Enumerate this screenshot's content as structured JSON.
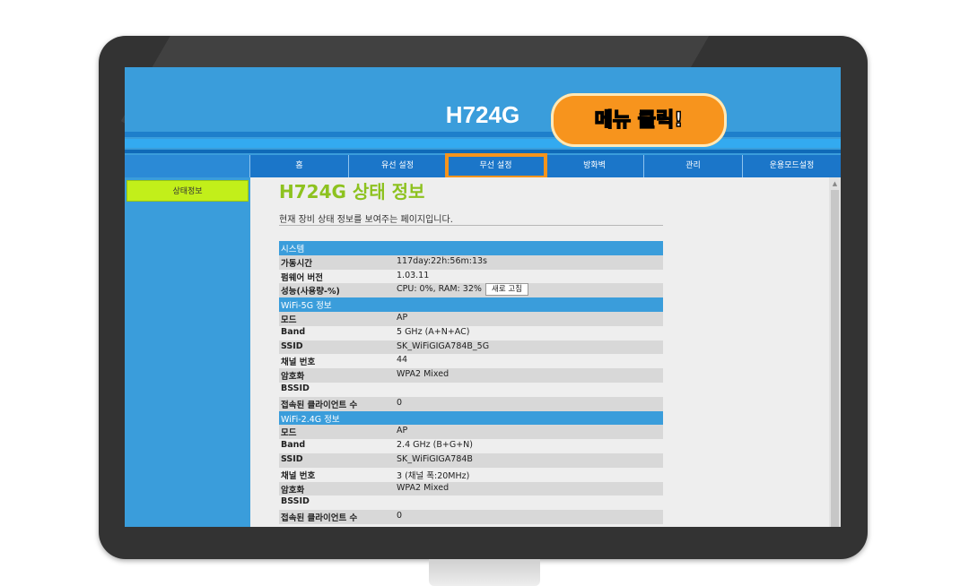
{
  "header": {
    "title": "H724G"
  },
  "nav": {
    "items": [
      {
        "label": "홈"
      },
      {
        "label": "유선 설정"
      },
      {
        "label": "무선 설정"
      },
      {
        "label": "방화벽"
      },
      {
        "label": "관리"
      },
      {
        "label": "운용모드설정"
      }
    ],
    "highlight_color": "#f5941d"
  },
  "sidebar": {
    "items": [
      {
        "label": "상태정보"
      }
    ]
  },
  "page": {
    "title": "H724G 상태 정보",
    "description": "현재 장비 상태 정보를 보여주는 페이지입니다."
  },
  "system": {
    "header": "시스템",
    "rows": [
      {
        "key": "가동시간",
        "value": "117day:22h:56m:13s"
      },
      {
        "key": "펌웨어 버전",
        "value": "1.03.11"
      },
      {
        "key": "성능(사용량-%)",
        "value": "CPU: 0%, RAM: 32%"
      }
    ],
    "refresh_label": "새로 고침"
  },
  "wifi5": {
    "header": "WiFi-5G 정보",
    "rows": [
      {
        "key": "모드",
        "value": "AP"
      },
      {
        "key": "Band",
        "value": "5 GHz (A+N+AC)"
      },
      {
        "key": "SSID",
        "value": "SK_WiFiGIGA784B_5G"
      },
      {
        "key": "채널 번호",
        "value": "44"
      },
      {
        "key": "암호화",
        "value": "WPA2 Mixed"
      },
      {
        "key": "BSSID",
        "value": ""
      },
      {
        "key": "접속된 클라이언트 수",
        "value": "0"
      }
    ]
  },
  "wifi24": {
    "header": "WiFi-2.4G 정보",
    "rows": [
      {
        "key": "모드",
        "value": "AP"
      },
      {
        "key": "Band",
        "value": "2.4 GHz (B+G+N)"
      },
      {
        "key": "SSID",
        "value": "SK_WiFiGIGA784B"
      },
      {
        "key": "채널 번호",
        "value": "3 (채널 폭:20MHz)"
      },
      {
        "key": "암호화",
        "value": "WPA2 Mixed"
      },
      {
        "key": "BSSID",
        "value": ""
      },
      {
        "key": "접속된 클라이언트 수",
        "value": "0"
      }
    ]
  },
  "callout": {
    "text": "메뉴 클릭!"
  },
  "colors": {
    "accent": "#3a9ddb",
    "title_green": "#8dc21f",
    "callout": "#f7941d",
    "sidebar_active": "#c2ef1a"
  }
}
